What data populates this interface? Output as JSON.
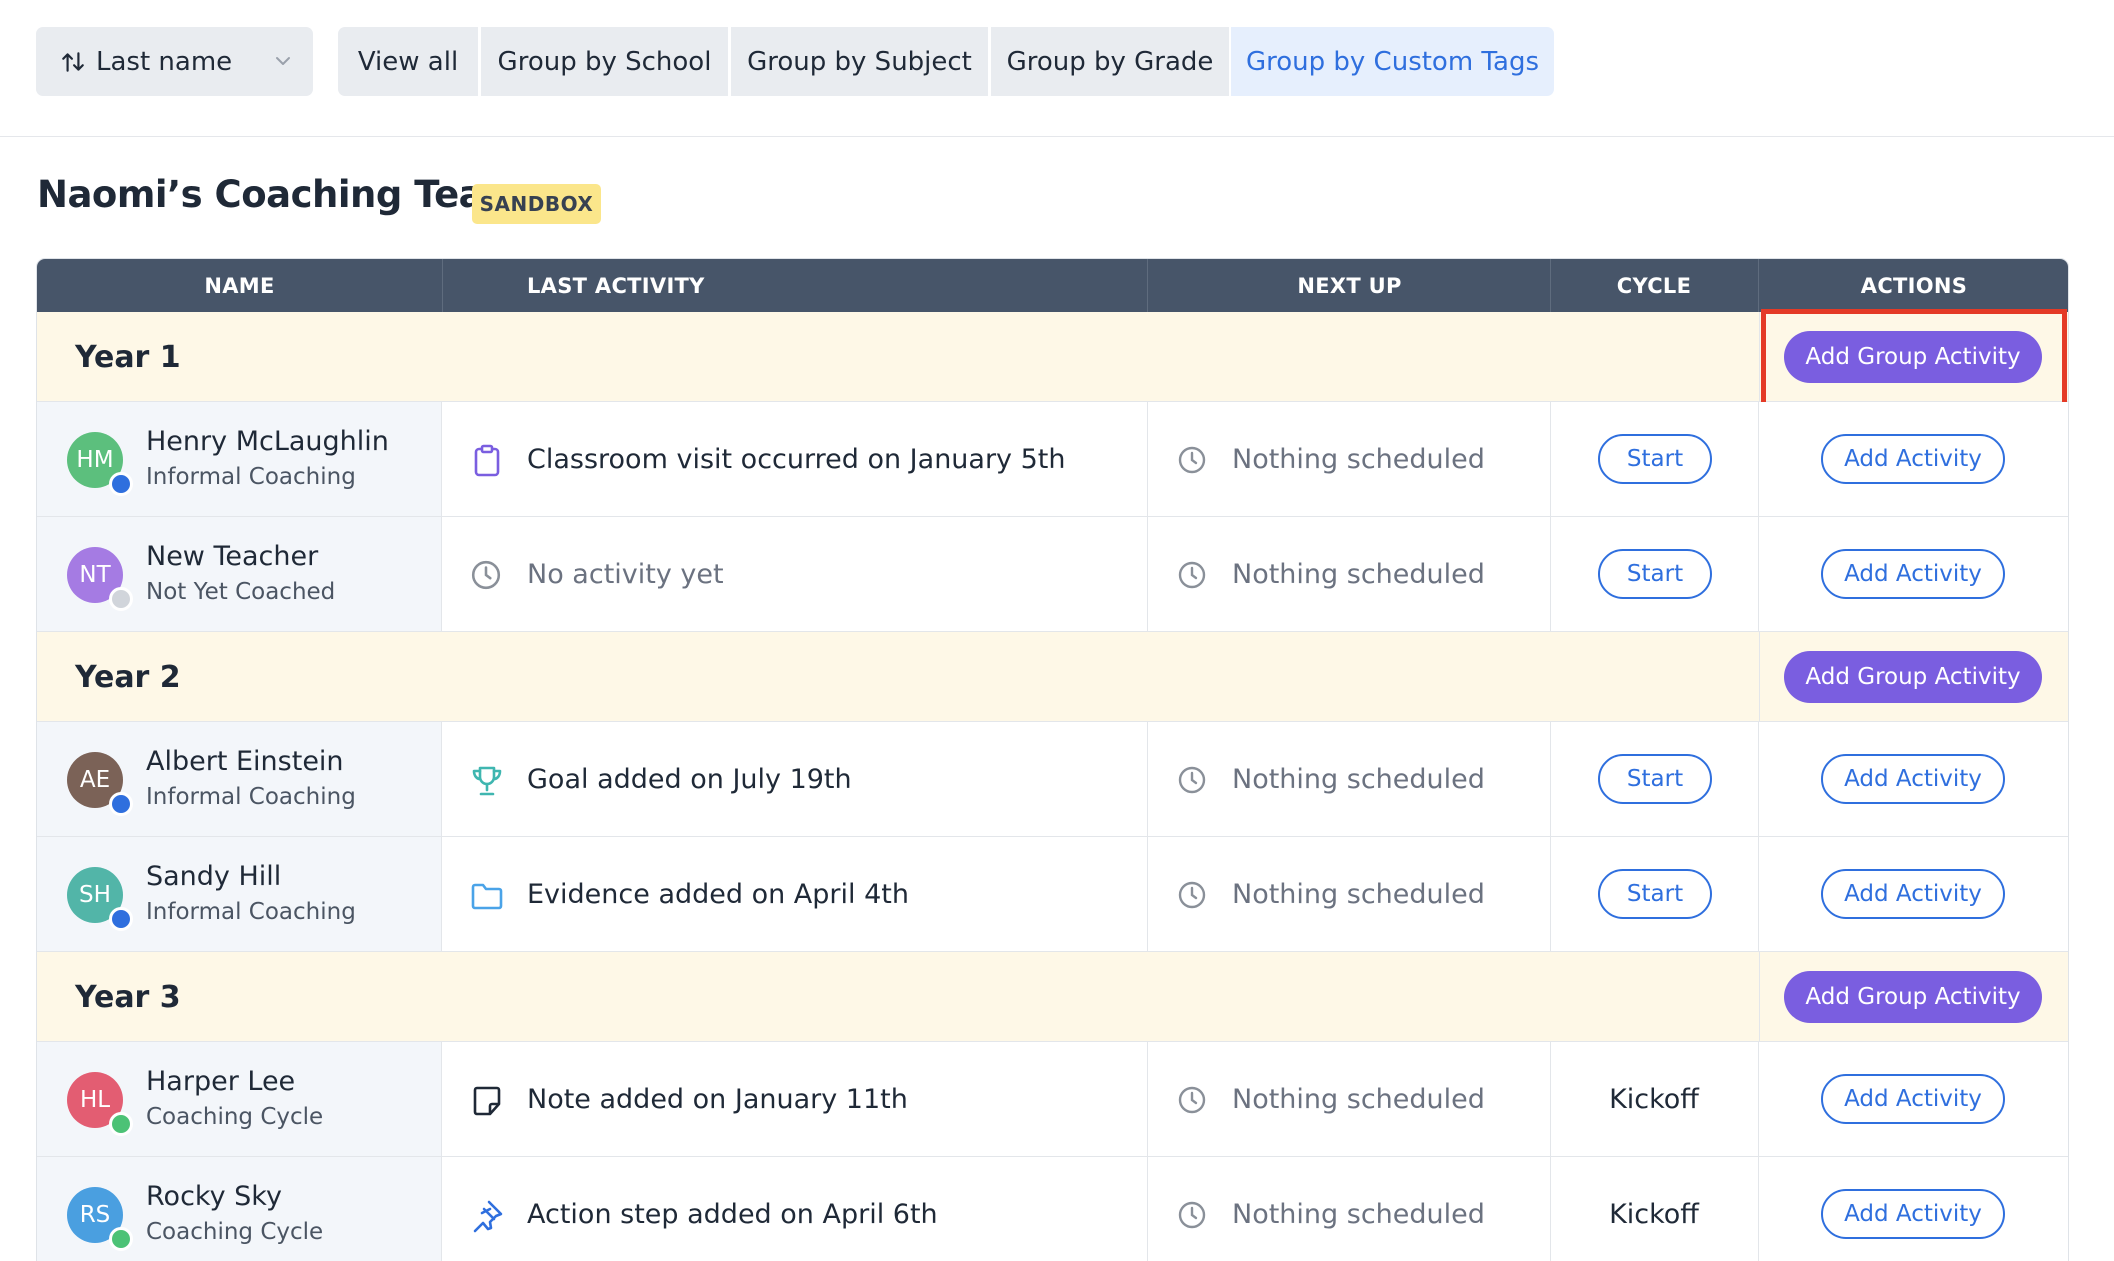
{
  "toolbar": {
    "sort_label": "Last name",
    "view_all": "View all",
    "group_by_school": "Group by School",
    "group_by_subject": "Group by Subject",
    "group_by_grade": "Group by Grade",
    "group_by_custom_tags": "Group by Custom Tags",
    "active_tab": "Group by Custom Tags"
  },
  "team": {
    "title": "Naomi’s Coaching Team",
    "badge": "SANDBOX"
  },
  "table": {
    "headers": {
      "name": "NAME",
      "last_activity": "LAST ACTIVITY",
      "next_up": "NEXT UP",
      "cycle": "CYCLE",
      "actions": "ACTIONS"
    },
    "groups": [
      {
        "label": "Year 1",
        "action": "Add Group Activity",
        "highlighted": true,
        "people": [
          {
            "initials": "HM",
            "name": "Henry McLaughlin",
            "status": "Informal Coaching",
            "avatar_color": "#5cbf7d",
            "dot_color": "#2f6fde",
            "activity_icon": "clipboard-icon",
            "last_activity": "Classroom visit occurred on January 5th",
            "next_up": "Nothing scheduled",
            "cycle": "Start",
            "action": "Add Activity"
          },
          {
            "initials": "NT",
            "name": "New Teacher",
            "status": "Not Yet Coached",
            "avatar_color": "#a57be3",
            "dot_color": "#d1d5db",
            "activity_icon": "clock-icon",
            "last_activity": "No activity yet",
            "next_up": "Nothing scheduled",
            "cycle": "Start",
            "action": "Add Activity"
          }
        ]
      },
      {
        "label": "Year 2",
        "action": "Add Group Activity",
        "highlighted": false,
        "people": [
          {
            "initials": "AE",
            "name": "Albert Einstein",
            "status": "Informal Coaching",
            "avatar_color": "#7b6257",
            "dot_color": "#2f6fde",
            "activity_icon": "trophy-icon",
            "last_activity": "Goal added on July 19th",
            "next_up": "Nothing scheduled",
            "cycle": "Start",
            "action": "Add Activity"
          },
          {
            "initials": "SH",
            "name": "Sandy Hill",
            "status": "Informal Coaching",
            "avatar_color": "#52b5a8",
            "dot_color": "#2f6fde",
            "activity_icon": "folder-icon",
            "last_activity": "Evidence added on April 4th",
            "next_up": "Nothing scheduled",
            "cycle": "Start",
            "action": "Add Activity"
          }
        ]
      },
      {
        "label": "Year 3",
        "action": "Add Group Activity",
        "highlighted": false,
        "people": [
          {
            "initials": "HL",
            "name": "Harper Lee",
            "status": "Coaching Cycle",
            "avatar_color": "#e35d72",
            "dot_color": "#4cc276",
            "activity_icon": "note-icon",
            "last_activity": "Note added on January 11th",
            "next_up": "Nothing scheduled",
            "cycle": "Kickoff",
            "action": "Add Activity"
          },
          {
            "initials": "RS",
            "name": "Rocky Sky",
            "status": "Coaching Cycle",
            "avatar_color": "#4a9fe0",
            "dot_color": "#4cc276",
            "activity_icon": "pin-icon",
            "last_activity": "Action step added on April 6th",
            "next_up": "Nothing scheduled",
            "cycle": "Kickoff",
            "action": "Add Activity"
          }
        ]
      }
    ]
  },
  "colors": {
    "primary_blue": "#2f6fde",
    "group_button_purple": "#7a5ee0",
    "header_slate": "#475569",
    "group_row_cream": "#fef8e7",
    "highlight_red": "#e43a26",
    "badge_yellow": "#fbe68b"
  }
}
